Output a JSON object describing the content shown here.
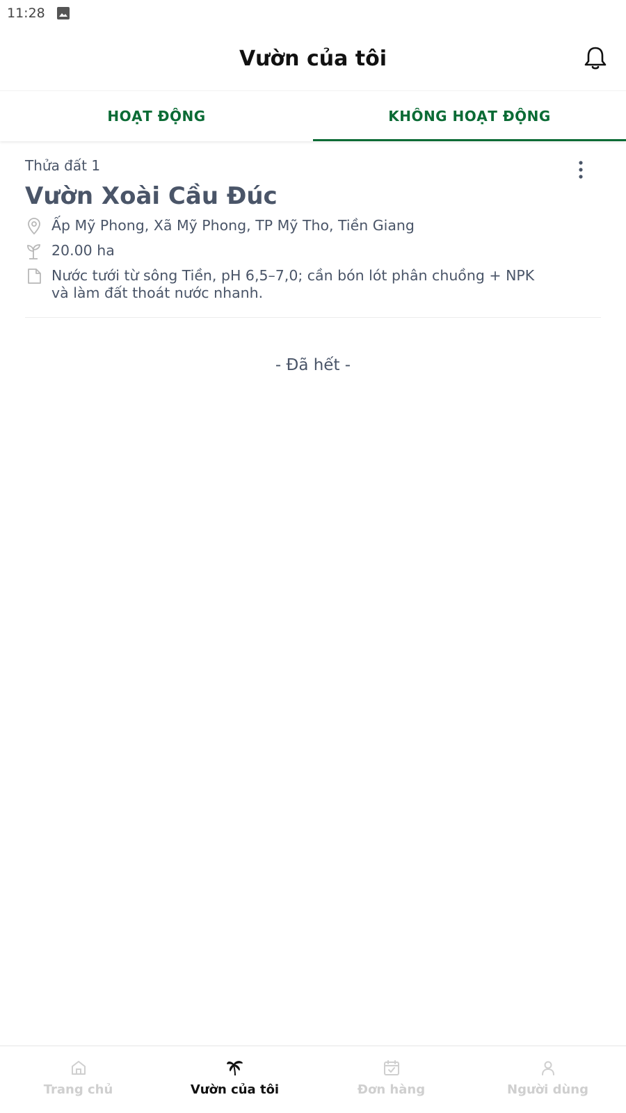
{
  "status_bar": {
    "time": "11:28"
  },
  "header": {
    "title": "Vườn của tôi"
  },
  "tabs": [
    {
      "label": "HOẠT ĐỘNG",
      "active": false
    },
    {
      "label": "KHÔNG HOẠT ĐỘNG",
      "active": true
    }
  ],
  "card": {
    "plot_label": "Thửa đất 1",
    "name": "Vườn Xoài Cầu Đúc",
    "address": "Ấp Mỹ Phong, Xã Mỹ Phong, TP Mỹ Tho, Tiền Giang",
    "area": "20.00 ha",
    "note": "Nước tưới từ sông Tiền, pH 6,5–7,0; cần bón lót phân chuồng + NPK và làm đất thoát nước nhanh."
  },
  "list_end": "- Đã hết -",
  "bottom_nav": [
    {
      "label": "Trang chủ",
      "icon": "home-icon",
      "active": false
    },
    {
      "label": "Vườn của tôi",
      "icon": "palm-tree-icon",
      "active": true
    },
    {
      "label": "Đơn hàng",
      "icon": "calendar-check-icon",
      "active": false
    },
    {
      "label": "Người dùng",
      "icon": "user-icon",
      "active": false
    }
  ],
  "colors": {
    "accent": "#0b6b35",
    "text": "#4a5568",
    "inactive_nav": "#cfcfcf"
  }
}
